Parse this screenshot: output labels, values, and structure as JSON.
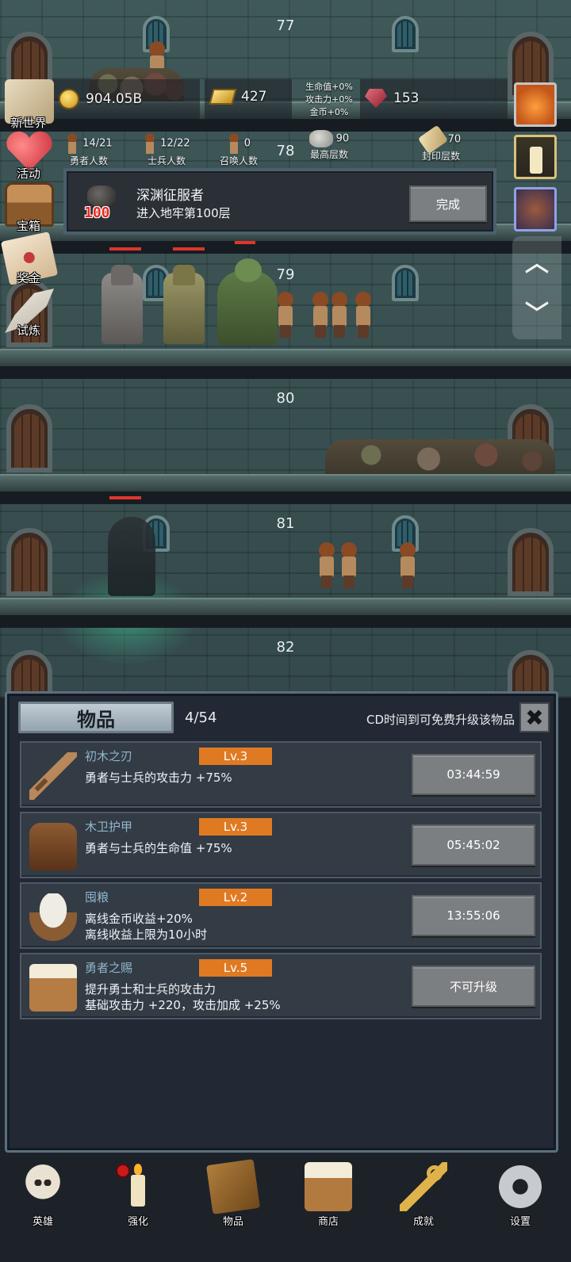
{
  "floors": [
    "77",
    "78",
    "79",
    "80",
    "81",
    "82"
  ],
  "resources": {
    "gold": "904.05B",
    "gold_bars": "427",
    "gems": "153",
    "bonus": {
      "hp": "生命值+0%",
      "atk": "攻击力+0%",
      "gold": "金币+0%"
    }
  },
  "stats": [
    {
      "value": "14/21",
      "label": "勇者人数"
    },
    {
      "value": "12/22",
      "label": "士兵人数"
    },
    {
      "value": "0",
      "label": "召唤人数"
    },
    {
      "value": "90",
      "label": "最高层数"
    },
    {
      "value": "70",
      "label": "封印层数"
    }
  ],
  "left_menu": [
    {
      "label": "新世界",
      "icon": "map-icon"
    },
    {
      "label": "活动",
      "icon": "heart-icon"
    },
    {
      "label": "宝箱",
      "icon": "chest-icon"
    },
    {
      "label": "奖金",
      "icon": "letter-icon"
    },
    {
      "label": "试炼",
      "icon": "feather-icon"
    }
  ],
  "achievement": {
    "badge": "100",
    "title": "深渊征服者",
    "desc": "进入地牢第100层",
    "button": "完成"
  },
  "panel": {
    "tab": "物品",
    "count": "4/54",
    "note": "CD时间到可免费升级该物品"
  },
  "items": [
    {
      "name": "初木之刃",
      "level": "Lv.3",
      "desc": "勇者与士兵的攻击力 +75%",
      "button": "03:44:59",
      "icon": "sword-icon"
    },
    {
      "name": "木卫护甲",
      "level": "Lv.3",
      "desc": "勇者与士兵的生命值 +75%",
      "button": "05:45:02",
      "icon": "armor-icon"
    },
    {
      "name": "囤粮",
      "level": "Lv.2",
      "desc": "离线金币收益+20%\n离线收益上限为10小时",
      "button": "13:55:06",
      "icon": "rice-bowl-icon"
    },
    {
      "name": "勇者之赐",
      "level": "Lv.5",
      "desc": "提升勇士和士兵的攻击力\n基础攻击力 +220，攻击加成 +25%",
      "button": "不可升级",
      "icon": "beer-mug-icon"
    }
  ],
  "nav": [
    {
      "label": "英雄",
      "icon": "skull-icon"
    },
    {
      "label": "强化",
      "icon": "candle-icon"
    },
    {
      "label": "物品",
      "icon": "book-icon"
    },
    {
      "label": "商店",
      "icon": "beer-mug-icon"
    },
    {
      "label": "成就",
      "icon": "key-icon"
    },
    {
      "label": "设置",
      "icon": "gear-icon"
    }
  ],
  "colors": {
    "level_badge": "#e07a22",
    "item_name": "#8fb6cc",
    "hp_bar": "#e0362a"
  }
}
